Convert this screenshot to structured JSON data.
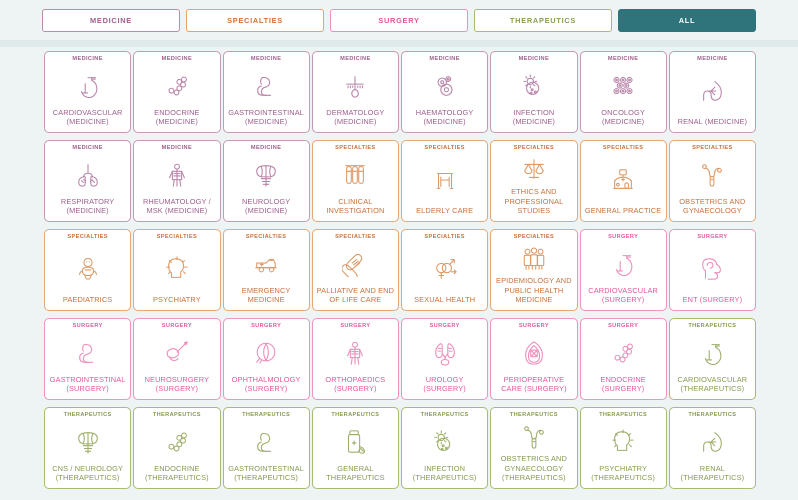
{
  "filter_bar": {
    "tabs": [
      {
        "label": "MEDICINE",
        "key": "medicine",
        "color": "#b98cab",
        "selected": false
      },
      {
        "label": "SPECIALTIES",
        "key": "specialties",
        "color": "#e8a368",
        "selected": false
      },
      {
        "label": "SURGERY",
        "key": "surgery",
        "color": "#ee8fbe",
        "selected": false
      },
      {
        "label": "THERAPEUTICS",
        "key": "therapeutics",
        "color": "#a9bb72",
        "selected": false
      },
      {
        "label": "ALL",
        "key": "all",
        "color": "#2f737b",
        "selected": true
      }
    ]
  },
  "theme": {
    "page_background": "#eef3f4",
    "divider": "#dfe9ea",
    "medicine": "#9e5f8c",
    "specialties": "#c9713c",
    "surgery": "#e2589e",
    "therapeutics": "#879a4e",
    "all_selected": "#2f737b"
  },
  "grid": {
    "columns": 8,
    "cards": [
      {
        "category": "MEDICINE",
        "theme": "medicine",
        "title": "CARDIOVASCULAR (MEDICINE)",
        "icon": "heart-icon"
      },
      {
        "category": "MEDICINE",
        "theme": "medicine",
        "title": "ENDOCRINE (MEDICINE)",
        "icon": "hormone-molecule-icon"
      },
      {
        "category": "MEDICINE",
        "theme": "medicine",
        "title": "GASTROINTESTINAL (MEDICINE)",
        "icon": "stomach-intestine-icon"
      },
      {
        "category": "MEDICINE",
        "theme": "medicine",
        "title": "DERMATOLOGY (MEDICINE)",
        "icon": "hair-follicle-skin-icon"
      },
      {
        "category": "MEDICINE",
        "theme": "medicine",
        "title": "HAEMATOLOGY (MEDICINE)",
        "icon": "blood-cells-icon"
      },
      {
        "category": "MEDICINE",
        "theme": "medicine",
        "title": "INFECTION (MEDICINE)",
        "icon": "virus-bacteria-icon"
      },
      {
        "category": "MEDICINE",
        "theme": "medicine",
        "title": "ONCOLOGY (MEDICINE)",
        "icon": "tumour-cells-icon"
      },
      {
        "category": "MEDICINE",
        "theme": "medicine",
        "title": "RENAL (MEDICINE)",
        "icon": "kidney-icon"
      },
      {
        "category": "MEDICINE",
        "theme": "medicine",
        "title": "RESPIRATORY (MEDICINE)",
        "icon": "lungs-icon"
      },
      {
        "category": "MEDICINE",
        "theme": "medicine",
        "title": "RHEUMATOLOGY / MSK (MEDICINE)",
        "icon": "skeleton-body-icon"
      },
      {
        "category": "MEDICINE",
        "theme": "medicine",
        "title": "NEUROLOGY (MEDICINE)",
        "icon": "brain-spine-icon"
      },
      {
        "category": "SPECIALTIES",
        "theme": "specialties",
        "title": "CLINICAL INVESTIGATION",
        "icon": "test-tubes-icon"
      },
      {
        "category": "SPECIALTIES",
        "theme": "specialties",
        "title": "ELDERLY CARE",
        "icon": "walking-frame-icon"
      },
      {
        "category": "SPECIALTIES",
        "theme": "specialties",
        "title": "ETHICS AND PROFESSIONAL STUDIES",
        "icon": "scales-of-justice-icon"
      },
      {
        "category": "SPECIALTIES",
        "theme": "specialties",
        "title": "GENERAL PRACTICE",
        "icon": "clinic-building-icon"
      },
      {
        "category": "SPECIALTIES",
        "theme": "specialties",
        "title": "OBSTETRICS AND GYNAECOLOGY",
        "icon": "uterus-icon"
      },
      {
        "category": "SPECIALTIES",
        "theme": "specialties",
        "title": "PAEDIATRICS",
        "icon": "baby-icon"
      },
      {
        "category": "SPECIALTIES",
        "theme": "specialties",
        "title": "PSYCHIATRY",
        "icon": "head-mind-icon"
      },
      {
        "category": "SPECIALTIES",
        "theme": "specialties",
        "title": "EMERGENCY MEDICINE",
        "icon": "ambulance-icon"
      },
      {
        "category": "SPECIALTIES",
        "theme": "specialties",
        "title": "PALLIATIVE AND END OF LIFE CARE",
        "icon": "interlocking-hearts-icon"
      },
      {
        "category": "SPECIALTIES",
        "theme": "specialties",
        "title": "SEXUAL HEALTH",
        "icon": "gender-symbols-icon"
      },
      {
        "category": "SPECIALTIES",
        "theme": "specialties",
        "title": "EPIDEMIOLOGY AND PUBLIC HEALTH MEDICINE",
        "icon": "population-group-icon"
      },
      {
        "category": "SURGERY",
        "theme": "surgery",
        "title": "CARDIOVASCULAR (SURGERY)",
        "icon": "heart-icon"
      },
      {
        "category": "SURGERY",
        "theme": "surgery",
        "title": "ENT (SURGERY)",
        "icon": "ear-nose-throat-icon"
      },
      {
        "category": "SURGERY",
        "theme": "surgery",
        "title": "GASTROINTESTINAL (SURGERY)",
        "icon": "stomach-intestine-icon"
      },
      {
        "category": "SURGERY",
        "theme": "surgery",
        "title": "NEUROSURGERY (SURGERY)",
        "icon": "brain-scalpel-icon"
      },
      {
        "category": "SURGERY",
        "theme": "surgery",
        "title": "OPHTHALMOLOGY (SURGERY)",
        "icon": "eye-icon"
      },
      {
        "category": "SURGERY",
        "theme": "surgery",
        "title": "ORTHOPAEDICS (SURGERY)",
        "icon": "skeleton-body-icon"
      },
      {
        "category": "SURGERY",
        "theme": "surgery",
        "title": "UROLOGY (SURGERY)",
        "icon": "kidneys-bladder-icon"
      },
      {
        "category": "SURGERY",
        "theme": "surgery",
        "title": "PERIOPERATIVE CARE (SURGERY)",
        "icon": "anaesthesia-mask-icon"
      },
      {
        "category": "SURGERY",
        "theme": "surgery",
        "title": "ENDOCRINE (SURGERY)",
        "icon": "hormone-molecule-icon"
      },
      {
        "category": "THERAPEUTICS",
        "theme": "therapeutics",
        "title": "CARDIOVASCULAR (THERAPEUTICS)",
        "icon": "heart-icon"
      },
      {
        "category": "THERAPEUTICS",
        "theme": "therapeutics",
        "title": "CNS / NEUROLOGY (THERAPEUTICS)",
        "icon": "brain-spine-icon"
      },
      {
        "category": "THERAPEUTICS",
        "theme": "therapeutics",
        "title": "ENDOCRINE (THERAPEUTICS)",
        "icon": "hormone-molecule-icon"
      },
      {
        "category": "THERAPEUTICS",
        "theme": "therapeutics",
        "title": "GASTROINTESTINAL (THERAPEUTICS)",
        "icon": "stomach-intestine-icon"
      },
      {
        "category": "THERAPEUTICS",
        "theme": "therapeutics",
        "title": "GENERAL THERAPEUTICS",
        "icon": "medicine-bottle-icon"
      },
      {
        "category": "THERAPEUTICS",
        "theme": "therapeutics",
        "title": "INFECTION (THERAPEUTICS)",
        "icon": "virus-bacteria-icon"
      },
      {
        "category": "THERAPEUTICS",
        "theme": "therapeutics",
        "title": "OBSTETRICS AND GYNAECOLOGY (THERAPEUTICS)",
        "icon": "uterus-icon"
      },
      {
        "category": "THERAPEUTICS",
        "theme": "therapeutics",
        "title": "PSYCHIATRY (THERAPEUTICS)",
        "icon": "head-mind-icon"
      },
      {
        "category": "THERAPEUTICS",
        "theme": "therapeutics",
        "title": "RENAL (THERAPEUTICS)",
        "icon": "kidney-icon"
      }
    ]
  }
}
